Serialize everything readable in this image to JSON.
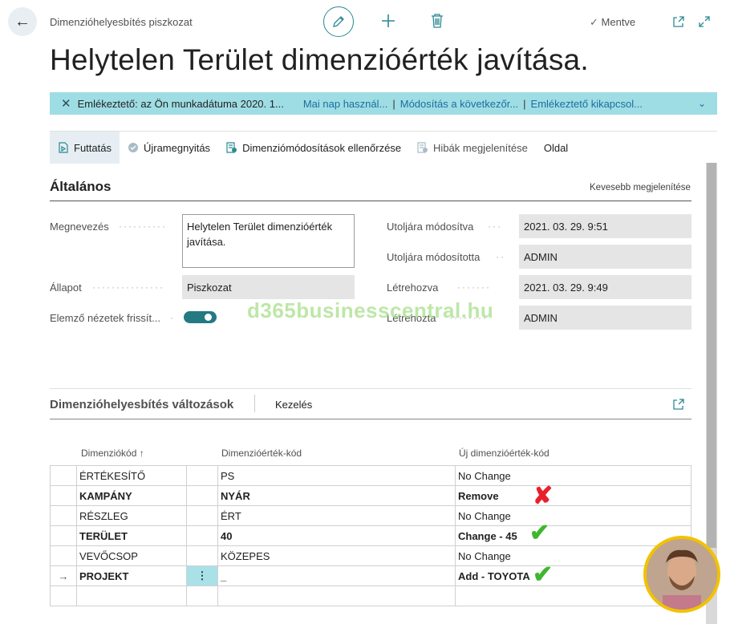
{
  "header": {
    "breadcrumb": "Dimenzióhelyesbítés piszkozat",
    "saved_label": "Mentve",
    "title": "Helytelen Terület dimenzióérték javítása."
  },
  "icons": {
    "back": "back-arrow-icon",
    "edit": "pencil-icon",
    "add": "plus-icon",
    "delete": "trash-icon",
    "check": "checkmark-icon",
    "open_new": "open-in-new-window-icon",
    "expand": "expand-icon"
  },
  "notification": {
    "message": "Emlékeztető: az Ön munkadátuma 2020. 1...",
    "links": [
      "Mai nap használ...",
      "Módosítás a következőr...",
      "Emlékeztető kikapcsol..."
    ]
  },
  "actions": [
    {
      "label": "Futtatás",
      "active": true
    },
    {
      "label": "Újramegnyitás"
    },
    {
      "label": "Dimenziómódosítások ellenőrzése"
    },
    {
      "label": "Hibák megjelenítése"
    },
    {
      "label": "Oldal"
    }
  ],
  "general": {
    "section_title": "Általános",
    "show_less": "Kevesebb megjelenítése",
    "fields": {
      "name_label": "Megnevezés",
      "name_value": "Helytelen Terület dimenzióérték javítása.",
      "status_label": "Állapot",
      "status_value": "Piszkozat",
      "analysis_label": "Elemző nézetek frissít...",
      "analysis_on": true,
      "modified_label": "Utoljára módosítva",
      "modified_value": "2021. 03. 29. 9:51",
      "modified_by_label": "Utoljára módosította",
      "modified_by_value": "ADMIN",
      "created_label": "Létrehozva",
      "created_value": "2021. 03. 29. 9:49",
      "created_by_label": "Létrehozta",
      "created_by_value": "ADMIN"
    }
  },
  "watermark": "d365businesscentral.hu",
  "changes": {
    "title": "Dimenzióhelyesbítés változások",
    "manage": "Kezelés",
    "columns": [
      "Dimenziókód",
      "Dimenzióérték-kód",
      "Új dimenzióérték-kód"
    ],
    "sort_indicator": "↑",
    "rows": [
      {
        "code": "ÉRTÉKESÍTŐ",
        "value": "PS",
        "new": "No Change",
        "bold": false
      },
      {
        "code": "KAMPÁNY",
        "value": "NYÁR",
        "new": "Remove",
        "bold": true,
        "mark": "cross"
      },
      {
        "code": "RÉSZLEG",
        "value": "ÉRT",
        "new": "No Change",
        "bold": false
      },
      {
        "code": "TERÜLET",
        "value": "40",
        "new": "Change - 45",
        "bold": true,
        "mark": "check"
      },
      {
        "code": "VEVŐCSOP",
        "value": "KÖZEPES",
        "new": "No Change",
        "bold": false
      },
      {
        "code": "PROJEKT",
        "value": "_",
        "new": "Add - TOYOTA",
        "bold": true,
        "mark": "check",
        "selected": true
      }
    ]
  },
  "colors": {
    "accent": "#2a8a93",
    "notification_bg": "#9fdde4",
    "cross": "#e8202a",
    "check": "#3fb62e"
  }
}
